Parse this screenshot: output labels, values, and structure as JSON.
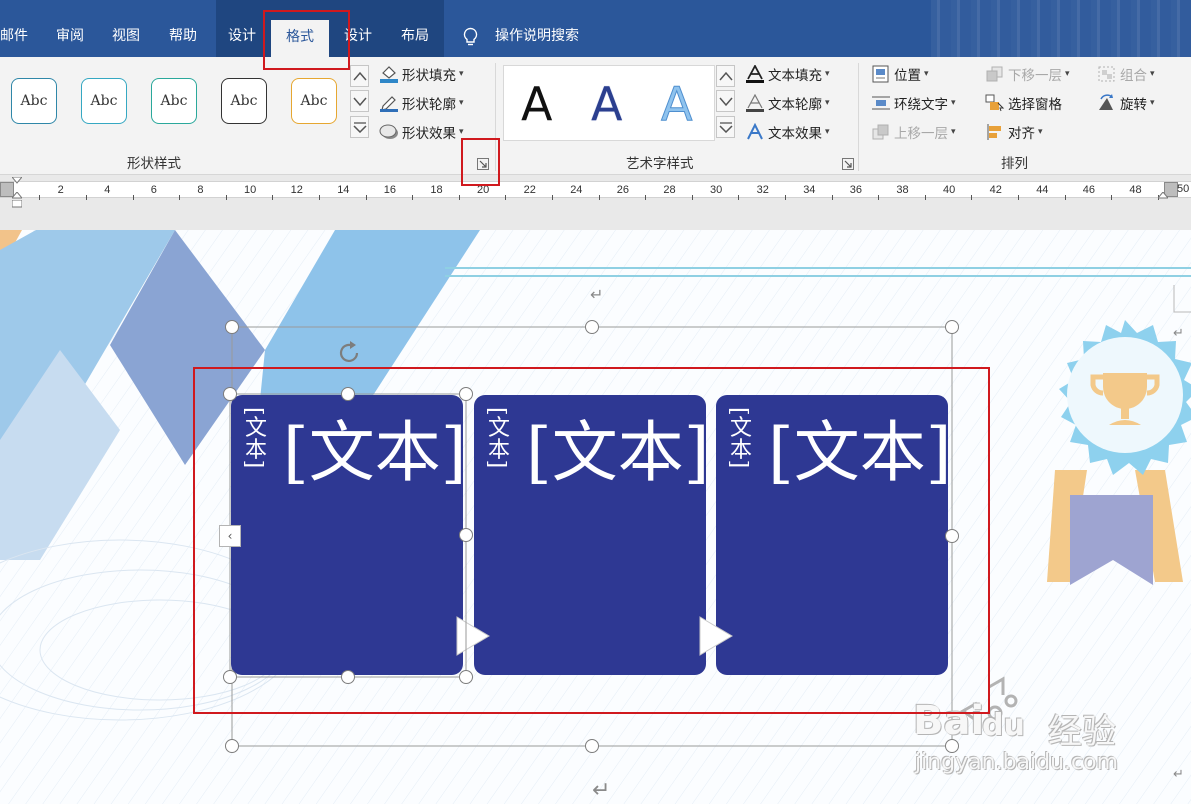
{
  "tabs": {
    "mail": "邮件",
    "review": "审阅",
    "view": "视图",
    "help": "帮助",
    "design1": "设计",
    "format": "格式",
    "design2": "设计",
    "layout": "布局",
    "search": "操作说明搜索"
  },
  "ribbon": {
    "shape_styles": {
      "samples": [
        "Abc",
        "Abc",
        "Abc",
        "Abc",
        "Abc"
      ],
      "sample_colors": [
        "#2f87a8",
        "#35a8c2",
        "#2aa89b",
        "#333333",
        "#e6a731"
      ],
      "fill": "形状填充",
      "outline": "形状轮廓",
      "effects": "形状效果",
      "label": "形状样式"
    },
    "wordart": {
      "samples": [
        "A",
        "A",
        "A"
      ],
      "fill": "文本填充",
      "outline": "文本轮廓",
      "effects": "文本效果",
      "label": "艺术字样式"
    },
    "arrange": {
      "position": "位置",
      "wrap_text": "环绕文字",
      "bring_forward": "上移一层",
      "send_backward": "下移一层",
      "selection_pane": "选择窗格",
      "align": "对齐",
      "group": "组合",
      "rotate": "旋转",
      "label": "排列"
    }
  },
  "ruler": {
    "numbers": [
      "2",
      "4",
      "6",
      "8",
      "10",
      "12",
      "14",
      "16",
      "18",
      "20",
      "22",
      "24",
      "26",
      "28",
      "30",
      "32",
      "34",
      "36",
      "38",
      "40",
      "42",
      "44",
      "46",
      "48"
    ],
    "end_label": "50"
  },
  "document": {
    "boxes": [
      {
        "vertical": "[文本]",
        "main": "[文本]"
      },
      {
        "vertical": "[文本]",
        "main": "[文本]"
      },
      {
        "vertical": "[文本]",
        "main": "[文本]"
      }
    ],
    "box_color": "#2e3893",
    "collapse_glyph": "‹"
  },
  "watermark": {
    "brand_latin": "Bai",
    "brand_du": "du",
    "brand_cn": "经验",
    "url": "jingyan.baidu.com"
  },
  "colors": {
    "ribbon_blue": "#2b579a",
    "highlight_red": "#d0191e",
    "ribbon_bg": "#f3f3f3"
  }
}
